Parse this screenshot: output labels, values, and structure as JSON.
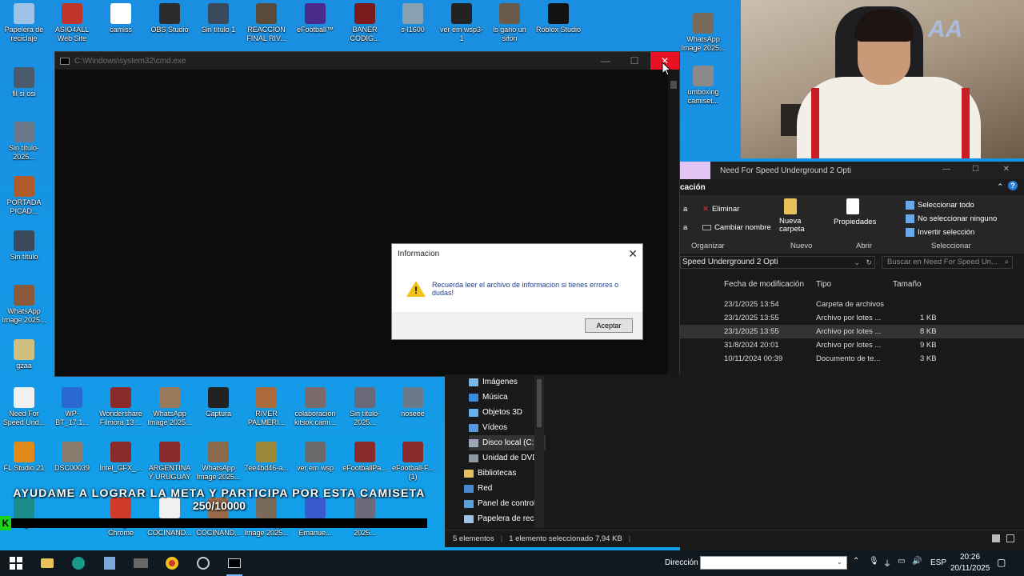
{
  "desktop": {
    "icons": [
      {
        "label": "Papelera de reciclaje",
        "color": "#9fc3e6"
      },
      {
        "label": "ASIO4ALL Web Site",
        "color": "#c0342c"
      },
      {
        "label": "camiss",
        "color": "#ffffff"
      },
      {
        "label": "OBS Studio",
        "color": "#2b2b2b"
      },
      {
        "label": "Sin título 1",
        "color": "#3a4a5a"
      },
      {
        "label": "REACCION FINAL RIV...",
        "color": "#5a4a3a"
      },
      {
        "label": "eFootball™",
        "color": "#4a2a8a"
      },
      {
        "label": "BANER CODIG...",
        "color": "#7a1a1a"
      },
      {
        "label": "s-l1600",
        "color": "#8aa0b0"
      },
      {
        "label": "ver em wsp3-1",
        "color": "#222222"
      },
      {
        "label": "ls gano un sifon",
        "color": "#6a5a4a"
      },
      {
        "label": "Roblox Studio",
        "color": "#111111"
      },
      {
        "label": "WhatsApp Image 2025...",
        "color": "#7a6a5a"
      },
      {
        "label": "umboxing camiset...",
        "color": "#8a8a8a"
      },
      {
        "label": "fil si osi",
        "color": "#4a5a6a"
      },
      {
        "label": "Sin título-2025...",
        "color": "#6a7a8a"
      },
      {
        "label": "PORTADA PICAD...",
        "color": "#b05a2a"
      },
      {
        "label": "Sin título",
        "color": "#3a4a5a"
      },
      {
        "label": "WhatsApp Image 2025...",
        "color": "#8a5a3a"
      },
      {
        "label": "gzaa",
        "color": "#d0c080"
      },
      {
        "label": "Need For Speed Und...",
        "color": "#f0f0f0"
      },
      {
        "label": "WP-BT_17.1...",
        "color": "#2a6ad0"
      },
      {
        "label": "Wondershare Filmora 13 ...",
        "color": "#8a2a2a"
      },
      {
        "label": "WhatsApp Image 2025...",
        "color": "#9a7a5a"
      },
      {
        "label": "Captura",
        "color": "#222222"
      },
      {
        "label": "RIVER PALMERI...",
        "color": "#aa6a3a"
      },
      {
        "label": "colaboracion kitsok cami...",
        "color": "#7a6a6a"
      },
      {
        "label": "Sin título-2025...",
        "color": "#6a6a7a"
      },
      {
        "label": "noseee",
        "color": "#6a7a8a"
      },
      {
        "label": "FL Studio 21",
        "color": "#e08a1a"
      },
      {
        "label": "DSC00039",
        "color": "#8a7a6a"
      },
      {
        "label": "Intel_GFX_...",
        "color": "#8a2a2a"
      },
      {
        "label": "ARGENTINA Y URUGUAY",
        "color": "#8a2a2a"
      },
      {
        "label": "WhatsApp Image 2025...",
        "color": "#8a6a4a"
      },
      {
        "label": "7ee4bd46-a...",
        "color": "#9a8a3a"
      },
      {
        "label": "ver em wsp",
        "color": "#6a6a6a"
      },
      {
        "label": "eFootballPa...",
        "color": "#8a2a2a"
      },
      {
        "label": "eFootball-F... (1)",
        "color": "#8a2a2a"
      },
      {
        "label": "Edge",
        "color": "#1a8a8a"
      },
      {
        "label": "Google Chrome",
        "color": "#d03a2a"
      },
      {
        "label": "PORTADA COCINAND...",
        "color": "#f0f0f0"
      },
      {
        "label": "PORTADA COCINAND...",
        "color": "#9a6a4a"
      },
      {
        "label": "WhatsApp Image 2025...",
        "color": "#7a6a5a"
      },
      {
        "label": "Cesaree Emanue...",
        "color": "#3a5ad0"
      },
      {
        "label": "Sin título-2025...",
        "color": "#6a6a7a"
      }
    ]
  },
  "cmd": {
    "title": "C:\\Windows\\system32\\cmd.exe",
    "minimize": "—",
    "maximize": "☐",
    "close": "✕"
  },
  "dialog": {
    "title": "Informacion",
    "close": "✕",
    "message": "Recuerda leer el archivo de informacion si tienes errores o dudas!",
    "button": "Aceptar",
    "icon": "!"
  },
  "explorer": {
    "title": "Need For Speed Underground 2 Opti",
    "ribbon_tab": "cación",
    "ribbon": {
      "eliminar": "Eliminar",
      "cambiar_nombre": "Cambiar nombre",
      "organizar": "Organizar",
      "nueva_carpeta": "Nueva carpeta",
      "nuevo": "Nuevo",
      "propiedades": "Propiedades",
      "abrir": "Abrir",
      "seleccionar_todo": "Seleccionar todo",
      "no_seleccionar": "No seleccionar ninguno",
      "invertir": "Invertir selección",
      "seleccionar": "Seleccionar",
      "left_a1": "a",
      "left_a2": "a"
    },
    "path": "Speed Underground 2 Opti",
    "search_placeholder": "Buscar en Need For Speed Un...",
    "columns": {
      "date": "Fecha de modificación",
      "type": "Tipo",
      "size": "Tamaño"
    },
    "rows": [
      {
        "date": "23/1/2025 13:54",
        "type": "Carpeta de archivos",
        "size": ""
      },
      {
        "date": "23/1/2025 13:55",
        "type": "Archivo por lotes ...",
        "size": "1 KB"
      },
      {
        "date": "23/1/2025 13:55",
        "type": "Archivo por lotes ...",
        "size": "8 KB"
      },
      {
        "date": "31/8/2024 20:01",
        "type": "Archivo por lotes ...",
        "size": "9 KB"
      },
      {
        "date": "10/11/2024 00:39",
        "type": "Documento de te...",
        "size": "3 KB"
      }
    ],
    "nav": [
      {
        "label": "Imágenes",
        "color": "#7fb6e8"
      },
      {
        "label": "Música",
        "color": "#3a8ae0"
      },
      {
        "label": "Objetos 3D",
        "color": "#6ab0e8"
      },
      {
        "label": "Vídeos",
        "color": "#5a9ae0"
      },
      {
        "label": "Disco local (C:)",
        "color": "#9aa8b8"
      },
      {
        "label": "Unidad de DVD",
        "color": "#8a98a8"
      },
      {
        "label": "Bibliotecas",
        "color": "#e0c060"
      },
      {
        "label": "Red",
        "color": "#4a8ad0"
      },
      {
        "label": "Panel de control",
        "color": "#5aa0d8"
      },
      {
        "label": "Papelera de recic",
        "color": "#9fc3e6"
      }
    ],
    "status": {
      "count": "5 elementos",
      "selected": "1 elemento seleccionado  7,94 KB"
    }
  },
  "webcam": {
    "watermark": "AA"
  },
  "banner": {
    "line1": "AYUDAME A LOGRAR LA META Y PARTICIPA POR ESTA CAMISETA",
    "line2": "250/10000",
    "progress": 0.025,
    "icon_letter": "K",
    "accent": "#1ad41a"
  },
  "taskbar": {
    "address_label": "Dirección",
    "lang": "ESP",
    "time": "20:26",
    "date": "20/11/2025"
  }
}
